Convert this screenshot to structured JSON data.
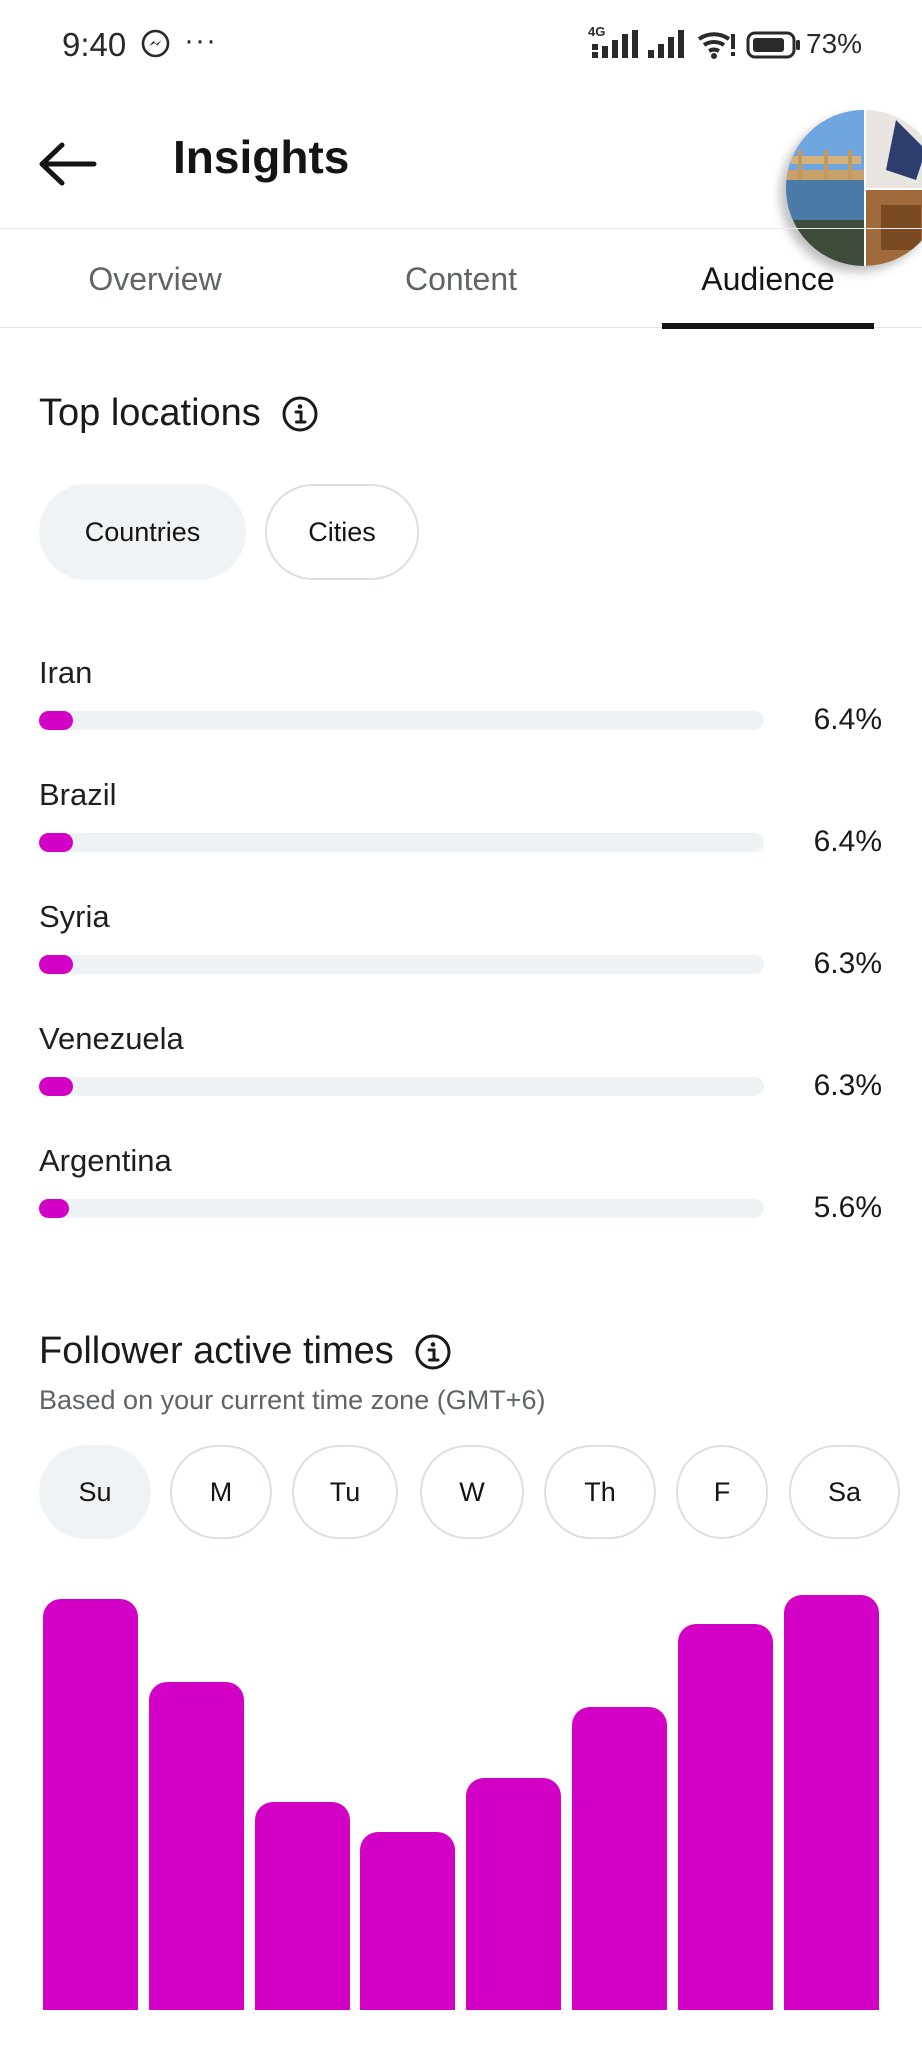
{
  "status_bar": {
    "time": "9:40",
    "dots": "···",
    "network": "4G",
    "battery_pct": "73%"
  },
  "header": {
    "title": "Insights"
  },
  "tabs": [
    {
      "label": "Overview",
      "active": false
    },
    {
      "label": "Content",
      "active": false
    },
    {
      "label": "Audience",
      "active": true
    }
  ],
  "top_locations": {
    "title": "Top locations",
    "filters": [
      {
        "label": "Countries",
        "selected": true
      },
      {
        "label": "Cities",
        "selected": false
      }
    ],
    "items": [
      {
        "name": "Iran",
        "pct_label": "6.4%",
        "value": 6.4
      },
      {
        "name": "Brazil",
        "pct_label": "6.4%",
        "value": 6.4
      },
      {
        "name": "Syria",
        "pct_label": "6.3%",
        "value": 6.3
      },
      {
        "name": "Venezuela",
        "pct_label": "6.3%",
        "value": 6.3
      },
      {
        "name": "Argentina",
        "pct_label": "5.6%",
        "value": 5.6
      }
    ]
  },
  "active_times": {
    "title": "Follower active times",
    "subtitle": "Based on your current time zone (GMT+6)",
    "days": [
      {
        "label": "Su",
        "selected": true
      },
      {
        "label": "M",
        "selected": false
      },
      {
        "label": "Tu",
        "selected": false
      },
      {
        "label": "W",
        "selected": false
      },
      {
        "label": "Th",
        "selected": false
      },
      {
        "label": "F",
        "selected": false
      },
      {
        "label": "Sa",
        "selected": false
      }
    ]
  },
  "accent_color": "#d300c5",
  "chart_data": {
    "type": "bar",
    "categories": [
      "",
      "",
      "",
      "",
      "",
      "",
      "",
      ""
    ],
    "values": [
      0.99,
      0.79,
      0.5,
      0.43,
      0.56,
      0.73,
      0.93,
      1.0
    ],
    "title": "",
    "xlabel": "",
    "ylabel": ""
  }
}
